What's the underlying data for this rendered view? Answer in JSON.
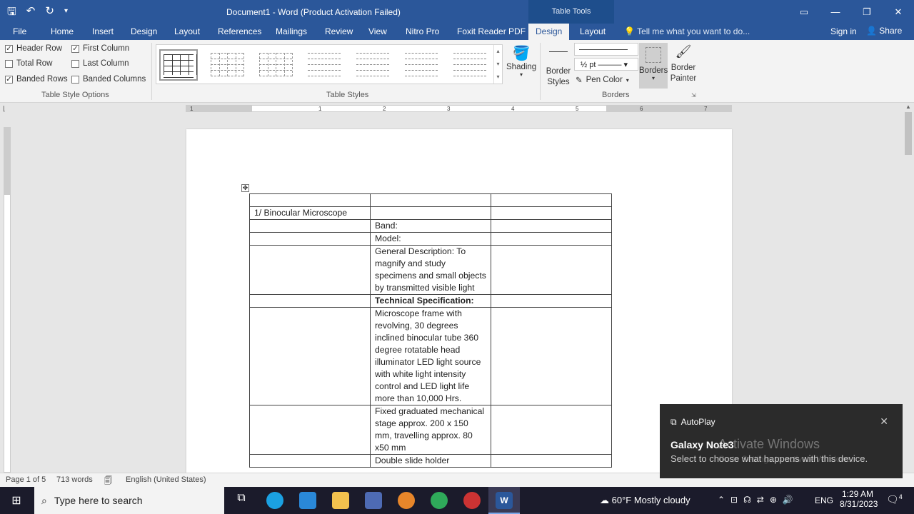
{
  "titlebar": {
    "doc_title": "Document1 - Word (Product Activation Failed)",
    "table_tools": "Table Tools"
  },
  "tabs": [
    {
      "label": "File",
      "active": false
    },
    {
      "label": "Home",
      "active": false
    },
    {
      "label": "Insert",
      "active": false
    },
    {
      "label": "Design",
      "active": false
    },
    {
      "label": "Layout",
      "active": false
    },
    {
      "label": "References",
      "active": false
    },
    {
      "label": "Mailings",
      "active": false
    },
    {
      "label": "Review",
      "active": false
    },
    {
      "label": "View",
      "active": false
    },
    {
      "label": "Nitro Pro",
      "active": false
    },
    {
      "label": "Foxit Reader PDF",
      "active": false
    },
    {
      "label": "Design",
      "active": true
    },
    {
      "label": "Layout",
      "active": false
    }
  ],
  "tell_me": "Tell me what you want to do...",
  "sign_in": "Sign in",
  "share": "Share",
  "table_style_options": {
    "label": "Table Style Options",
    "options": [
      {
        "label": "Header Row",
        "checked": true
      },
      {
        "label": "First Column",
        "checked": true
      },
      {
        "label": "Total Row",
        "checked": false
      },
      {
        "label": "Last Column",
        "checked": false
      },
      {
        "label": "Banded Rows",
        "checked": true
      },
      {
        "label": "Banded Columns",
        "checked": false
      }
    ]
  },
  "table_styles": {
    "label": "Table Styles"
  },
  "shading": "Shading",
  "borders_group": {
    "label": "Borders",
    "border_styles": "Border Styles",
    "weight": "½ pt",
    "pen_color": "Pen Color",
    "borders": "Borders",
    "border_painter": "Border Painter"
  },
  "ruler_numbers": [
    "1",
    "1",
    "2",
    "3",
    "4",
    "5",
    "6",
    "7"
  ],
  "document": {
    "rows": [
      [
        "",
        "",
        ""
      ],
      [
        "1/ Binocular Microscope",
        "",
        ""
      ],
      [
        "",
        "Band:",
        ""
      ],
      [
        "",
        "Model:",
        ""
      ],
      [
        "",
        "General Description: To magnify and study specimens and small objects by transmitted visible light",
        ""
      ],
      [
        "",
        "Technical Specification:",
        ""
      ],
      [
        "",
        "Microscope frame with revolving, 30 degrees inclined binocular tube 360 degree rotatable head illuminator LED light source with white light intensity control and LED light life more than 10,000 Hrs.",
        ""
      ],
      [
        "",
        "Fixed graduated mechanical stage approx. 200 x 150 mm, travelling approx. 80 x50 mm",
        ""
      ],
      [
        "",
        "Double slide holder",
        ""
      ]
    ]
  },
  "status": {
    "page": "Page 1 of 5",
    "words": "713 words",
    "language": "English (United States)"
  },
  "toast": {
    "app": "AutoPlay",
    "title": "Galaxy Note3",
    "message": "Select to choose what happens with this device.",
    "watermark": "Activate Windows",
    "watermark_sub": "Go to Settings to activate Windows."
  },
  "taskbar": {
    "search_placeholder": "Type here to search",
    "weather": "60°F  Mostly cloudy",
    "lang": "ENG",
    "time": "1:29 AM",
    "date": "8/31/2023",
    "notif_count": "4"
  }
}
